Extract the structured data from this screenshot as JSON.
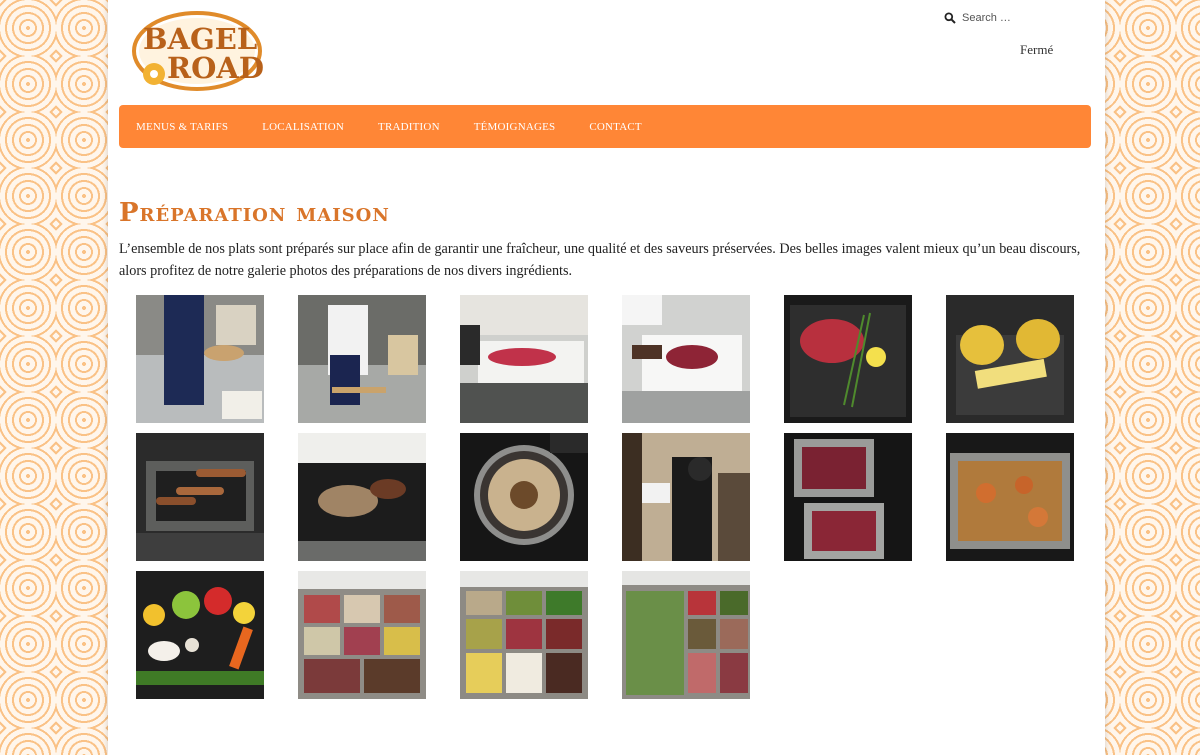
{
  "brand": {
    "logo_line1": "BAGEL",
    "logo_line2": "ROAD"
  },
  "search": {
    "placeholder": "Search …"
  },
  "status": {
    "hours_text": "Fermé"
  },
  "nav": {
    "items": [
      {
        "label": "Menus & Tarifs"
      },
      {
        "label": "Localisation"
      },
      {
        "label": "Tradition"
      },
      {
        "label": "Témoignages"
      },
      {
        "label": "Contact"
      }
    ]
  },
  "main": {
    "title": "Préparation maison",
    "intro": "L’ensemble de nos plats sont préparés sur place afin de garantir une fraîcheur, une qualité et des saveurs préservées. Des belles images valent mieux qu’un beau discours, alors profitez de notre galerie photos des préparations de nos divers ingrédients."
  },
  "colors": {
    "accent": "#ff8636",
    "title": "#d9752a",
    "logo": "#b8611a"
  }
}
